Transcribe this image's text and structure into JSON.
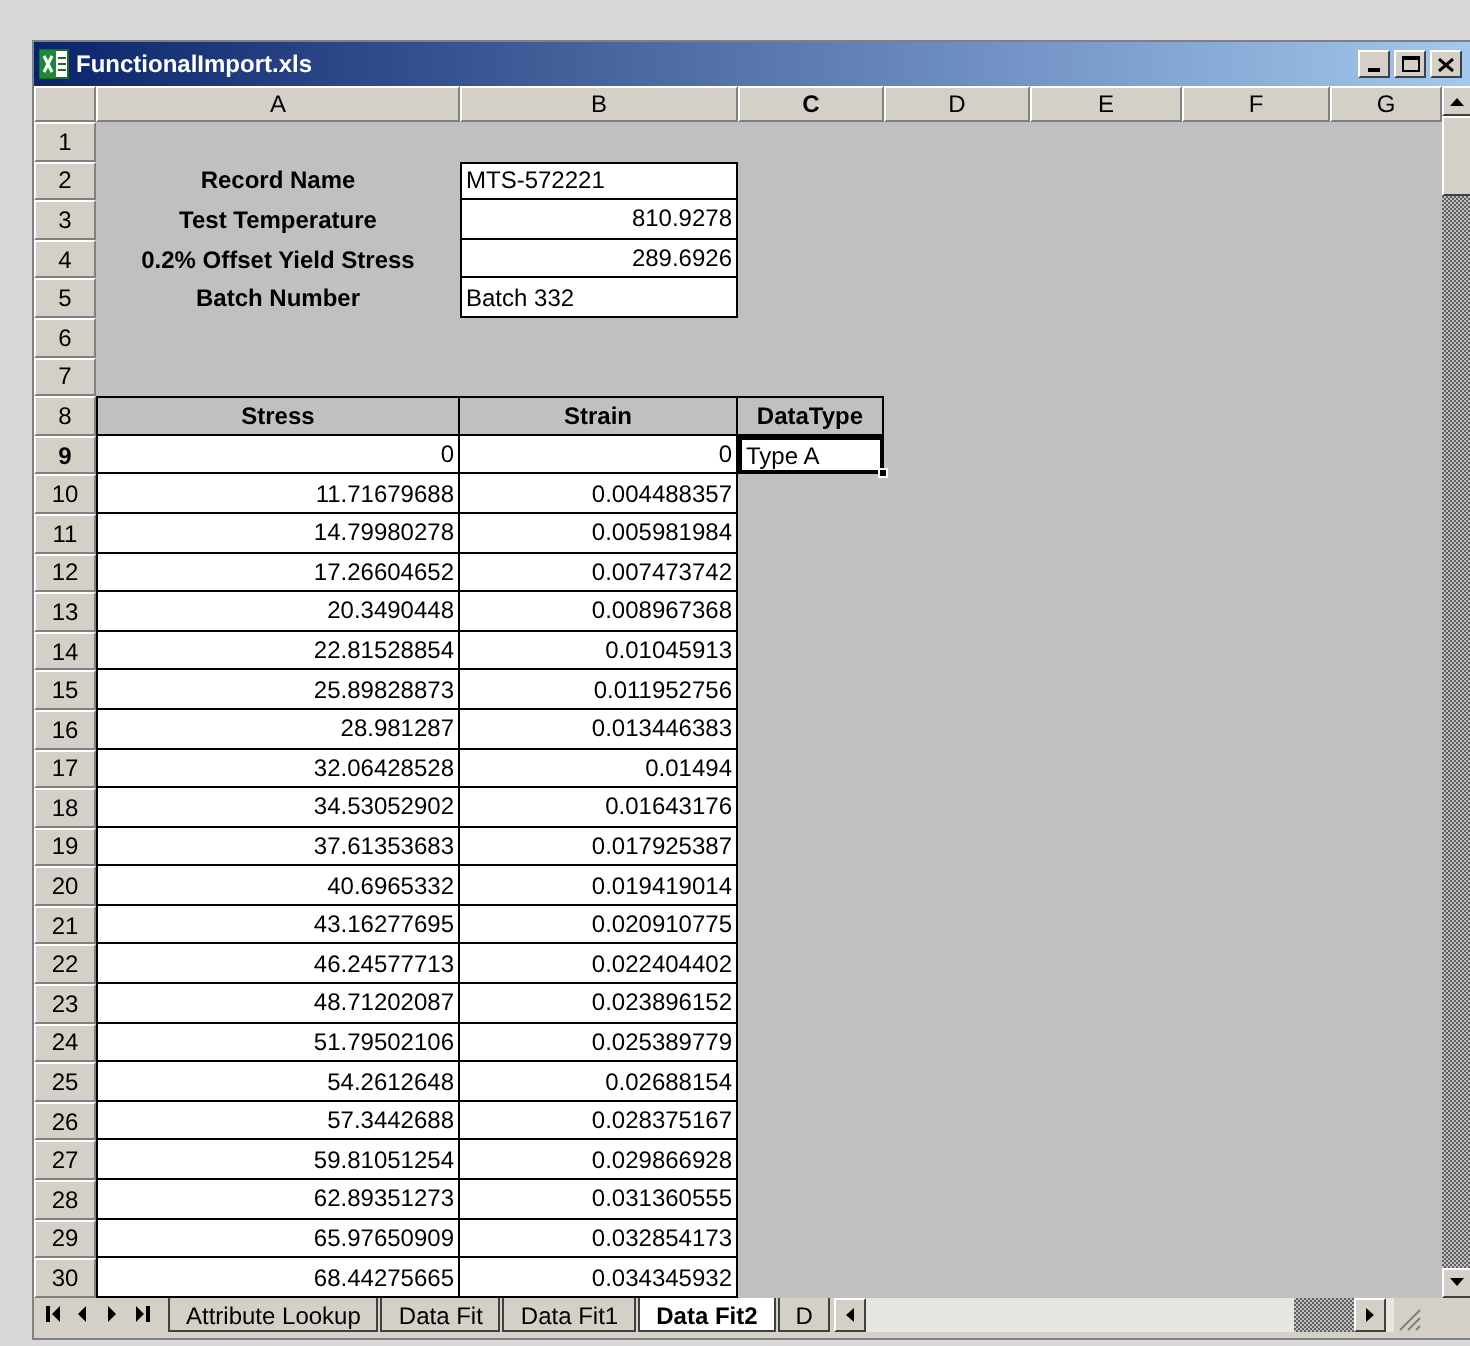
{
  "window": {
    "title": "FunctionalImport.xls"
  },
  "column_headers": [
    {
      "label": "A",
      "selected": false
    },
    {
      "label": "B",
      "selected": false
    },
    {
      "label": "C",
      "selected": true
    },
    {
      "label": "D",
      "selected": false
    },
    {
      "label": "E",
      "selected": false
    },
    {
      "label": "F",
      "selected": false
    },
    {
      "label": "G",
      "selected": false
    }
  ],
  "row_headers": [
    {
      "label": "1",
      "selected": false
    },
    {
      "label": "2",
      "selected": false
    },
    {
      "label": "3",
      "selected": false
    },
    {
      "label": "4",
      "selected": false
    },
    {
      "label": "5",
      "selected": false
    },
    {
      "label": "6",
      "selected": false
    },
    {
      "label": "7",
      "selected": false
    },
    {
      "label": "8",
      "selected": false
    },
    {
      "label": "9",
      "selected": true
    },
    {
      "label": "10",
      "selected": false
    },
    {
      "label": "11",
      "selected": false
    },
    {
      "label": "12",
      "selected": false
    },
    {
      "label": "13",
      "selected": false
    },
    {
      "label": "14",
      "selected": false
    },
    {
      "label": "15",
      "selected": false
    },
    {
      "label": "16",
      "selected": false
    },
    {
      "label": "17",
      "selected": false
    },
    {
      "label": "18",
      "selected": false
    },
    {
      "label": "19",
      "selected": false
    },
    {
      "label": "20",
      "selected": false
    },
    {
      "label": "21",
      "selected": false
    },
    {
      "label": "22",
      "selected": false
    },
    {
      "label": "23",
      "selected": false
    },
    {
      "label": "24",
      "selected": false
    },
    {
      "label": "25",
      "selected": false
    },
    {
      "label": "26",
      "selected": false
    },
    {
      "label": "27",
      "selected": false
    },
    {
      "label": "28",
      "selected": false
    },
    {
      "label": "29",
      "selected": false
    },
    {
      "label": "30",
      "selected": false
    }
  ],
  "fields": [
    {
      "label": "Record Name",
      "value": "MTS-572221",
      "kind": "text"
    },
    {
      "label": "Test Temperature",
      "value": "810.9278",
      "kind": "number"
    },
    {
      "label": "0.2% Offset Yield Stress",
      "value": "289.6926",
      "kind": "number"
    },
    {
      "label": "Batch Number",
      "value": "Batch 332",
      "kind": "text"
    }
  ],
  "table": {
    "columns": [
      "Stress",
      "Strain",
      "DataType"
    ],
    "rows": [
      {
        "stress": "0",
        "strain": "0",
        "data_type": {
          "text": "Type A",
          "selected": true
        }
      },
      {
        "stress": "11.71679688",
        "strain": "0.004488357"
      },
      {
        "stress": "14.79980278",
        "strain": "0.005981984"
      },
      {
        "stress": "17.26604652",
        "strain": "0.007473742"
      },
      {
        "stress": "20.3490448",
        "strain": "0.008967368"
      },
      {
        "stress": "22.81528854",
        "strain": "0.01045913"
      },
      {
        "stress": "25.89828873",
        "strain": "0.011952756"
      },
      {
        "stress": "28.981287",
        "strain": "0.013446383"
      },
      {
        "stress": "32.06428528",
        "strain": "0.01494"
      },
      {
        "stress": "34.53052902",
        "strain": "0.01643176"
      },
      {
        "stress": "37.61353683",
        "strain": "0.017925387"
      },
      {
        "stress": "40.6965332",
        "strain": "0.019419014"
      },
      {
        "stress": "43.16277695",
        "strain": "0.020910775"
      },
      {
        "stress": "46.24577713",
        "strain": "0.022404402"
      },
      {
        "stress": "48.71202087",
        "strain": "0.023896152"
      },
      {
        "stress": "51.79502106",
        "strain": "0.025389779"
      },
      {
        "stress": "54.2612648",
        "strain": "0.02688154"
      },
      {
        "stress": "57.3442688",
        "strain": "0.028375167"
      },
      {
        "stress": "59.81051254",
        "strain": "0.029866928"
      },
      {
        "stress": "62.89351273",
        "strain": "0.031360555"
      },
      {
        "stress": "65.97650909",
        "strain": "0.032854173"
      },
      {
        "stress": "68.44275665",
        "strain": "0.034345932"
      }
    ]
  },
  "sheet_tabs": [
    {
      "label": "Attribute Lookup",
      "selected": false
    },
    {
      "label": "Data Fit",
      "selected": false
    },
    {
      "label": "Data Fit1",
      "selected": false
    },
    {
      "label": "Data Fit2",
      "selected": true
    },
    {
      "label": "D",
      "selected": false
    }
  ]
}
